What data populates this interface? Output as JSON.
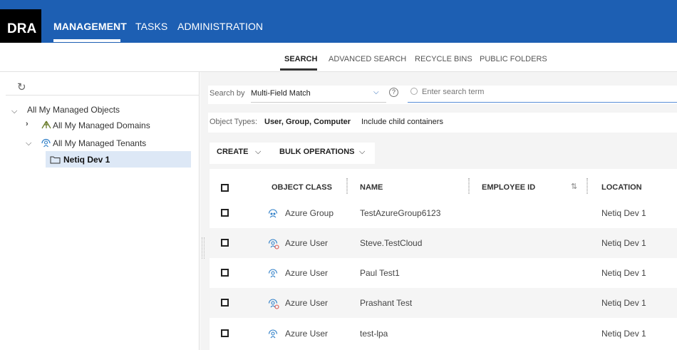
{
  "app": {
    "logo": "DRA"
  },
  "topnav": [
    "MANAGEMENT",
    "TASKS",
    "ADMINISTRATION"
  ],
  "subnav": [
    "SEARCH",
    "ADVANCED SEARCH",
    "RECYCLE BINS",
    "PUBLIC FOLDERS"
  ],
  "tree": {
    "root": "All My Managed Objects",
    "domains": "All My Managed Domains",
    "tenants": "All My Managed Tenants",
    "selected": "Netiq Dev 1"
  },
  "search": {
    "by_label": "Search by",
    "by_value": "Multi-Field Match",
    "placeholder": "Enter search term",
    "object_types_label": "Object Types:",
    "object_types_value": "User, Group, Computer",
    "include_child": "Include child containers"
  },
  "toolbar": {
    "create": "CREATE",
    "bulk": "BULK OPERATIONS"
  },
  "table": {
    "columns": [
      "OBJECT CLASS",
      "NAME",
      "EMPLOYEE ID",
      "LOCATION"
    ],
    "rows": [
      {
        "class": "Azure Group",
        "name": "TestAzureGroup6123",
        "employee_id": "",
        "location": "Netiq Dev 1",
        "icon": "azure-group-icon"
      },
      {
        "class": "Azure User",
        "name": "Steve.TestCloud",
        "employee_id": "",
        "location": "Netiq Dev 1",
        "icon": "azure-user-disabled-icon"
      },
      {
        "class": "Azure User",
        "name": "Paul Test1",
        "employee_id": "",
        "location": "Netiq Dev 1",
        "icon": "azure-user-icon"
      },
      {
        "class": "Azure User",
        "name": "Prashant Test",
        "employee_id": "",
        "location": "Netiq Dev 1",
        "icon": "azure-user-disabled-icon"
      },
      {
        "class": "Azure User",
        "name": "test-lpa",
        "employee_id": "",
        "location": "Netiq Dev 1",
        "icon": "azure-user-icon"
      }
    ]
  },
  "colors": {
    "brand_blue": "#1d5fb3",
    "selection": "#dde8f6"
  }
}
